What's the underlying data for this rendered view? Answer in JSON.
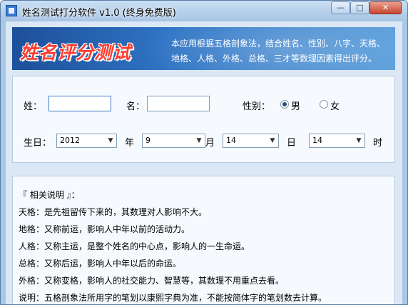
{
  "window": {
    "title": "姓名测试打分软件 v1.0 (终身免费版)",
    "controls": {
      "minimize": "—",
      "maximize": "□",
      "close": "✕"
    }
  },
  "banner": {
    "logo_text": "姓名评分测试",
    "description_lines": [
      "本应用根据五格剖象法，结合姓名、性别、八字、天格、",
      "地格、人格、外格、总格、三才等数理因素得出评分。"
    ]
  },
  "form": {
    "surname_label": "姓：",
    "surname_value": "",
    "name_label": "名：",
    "name_value": "",
    "gender_label": "性别：",
    "gender_options": [
      {
        "label": "男",
        "checked": true
      },
      {
        "label": "女",
        "checked": false
      }
    ],
    "birthday_label": "生日：",
    "year": {
      "value": "2012",
      "unit": "年"
    },
    "month": {
      "value": "9",
      "unit": "月"
    },
    "day": {
      "value": "14",
      "unit": "日"
    },
    "hour": {
      "value": "14",
      "unit": "时"
    }
  },
  "info": {
    "heading": "『 相关说明 』：",
    "lines": [
      "天格：是先祖留传下来的，其数理对人影响不大。",
      "地格：又称前运，影响人中年以前的活动力。",
      "人格：又称主运，是整个姓名的中心点，影响人的一生命运。",
      "总格：又称后运，影响人中年以后的命运。",
      "外格：又称变格，影响人的社交能力、智慧等，其数理不用重点去看。",
      "说明：五格剖象法所用字的笔划以康熙字典为准，不能按简体字的笔划数去计算。"
    ]
  }
}
